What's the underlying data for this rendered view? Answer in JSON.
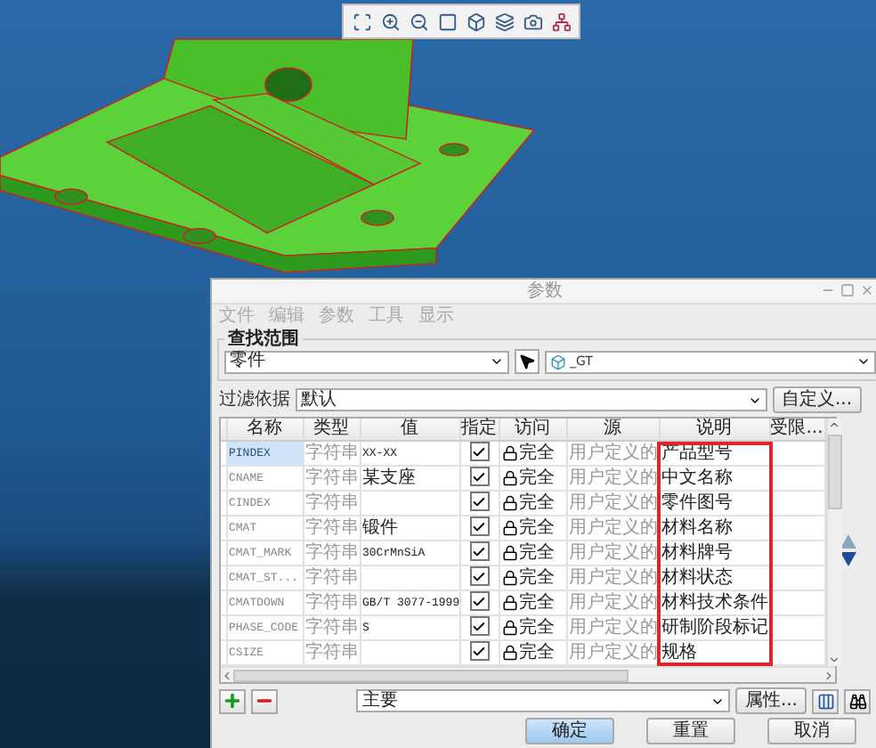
{
  "dialog": {
    "title": "参数",
    "menu": [
      {
        "label": "文件",
        "disabled": true
      },
      {
        "label": "编辑",
        "disabled": true
      },
      {
        "label": "参数",
        "disabled": true
      },
      {
        "label": "工具",
        "disabled": true
      },
      {
        "label": "显示",
        "disabled": true
      }
    ],
    "lookup": {
      "legend": "查找范围",
      "scope": "零件",
      "model": "_GT"
    },
    "filter": {
      "label": "过滤依据",
      "value": "默认",
      "button": "自定义..."
    },
    "columns": [
      {
        "label": "名称",
        "highlighted": false
      },
      {
        "label": "类型",
        "highlighted": false
      },
      {
        "label": "值",
        "highlighted": false
      },
      {
        "label": "指定",
        "highlighted": false
      },
      {
        "label": "访问",
        "highlighted": false
      },
      {
        "label": "源",
        "highlighted": false
      },
      {
        "label": "说明",
        "highlighted": true
      },
      {
        "label": "受限...",
        "highlighted": false
      }
    ],
    "rows": [
      {
        "name": "PINDEX",
        "type": "字符串",
        "value": "XX-XX",
        "designated": true,
        "access": "完全",
        "source": "用户定义的",
        "description": "产品型号",
        "selected": true
      },
      {
        "name": "CNAME",
        "type": "字符串",
        "value": "某支座",
        "designated": true,
        "access": "完全",
        "source": "用户定义的",
        "description": "中文名称",
        "selected": false
      },
      {
        "name": "CINDEX",
        "type": "字符串",
        "value": "",
        "designated": true,
        "access": "完全",
        "source": "用户定义的",
        "description": "零件图号",
        "selected": false
      },
      {
        "name": "CMAT",
        "type": "字符串",
        "value": "锻件",
        "designated": true,
        "access": "完全",
        "source": "用户定义的",
        "description": "材料名称",
        "selected": false
      },
      {
        "name": "CMAT_MARK",
        "type": "字符串",
        "value": "30CrMnSiA",
        "designated": true,
        "access": "完全",
        "source": "用户定义的",
        "description": "材料牌号",
        "selected": false
      },
      {
        "name": "CMAT_ST...",
        "type": "字符串",
        "value": "",
        "designated": true,
        "access": "完全",
        "source": "用户定义的",
        "description": "材料状态",
        "selected": false
      },
      {
        "name": "CMATDOWN",
        "type": "字符串",
        "value": "GB/T 3077-1999",
        "designated": true,
        "access": "完全",
        "source": "用户定义的",
        "description": "材料技术条件",
        "selected": false
      },
      {
        "name": "PHASE_CODE",
        "type": "字符串",
        "value": "S",
        "designated": true,
        "access": "完全",
        "source": "用户定义的",
        "description": "研制阶段标记",
        "selected": false
      },
      {
        "name": "CSIZE",
        "type": "字符串",
        "value": "",
        "designated": true,
        "access": "完全",
        "source": "用户定义的",
        "description": "规格",
        "selected": false
      }
    ],
    "category": "主要",
    "properties_button": "属性...",
    "buttons": [
      {
        "label": "确定",
        "default": true
      },
      {
        "label": "重置",
        "default": false
      },
      {
        "label": "取消",
        "default": false
      }
    ]
  }
}
